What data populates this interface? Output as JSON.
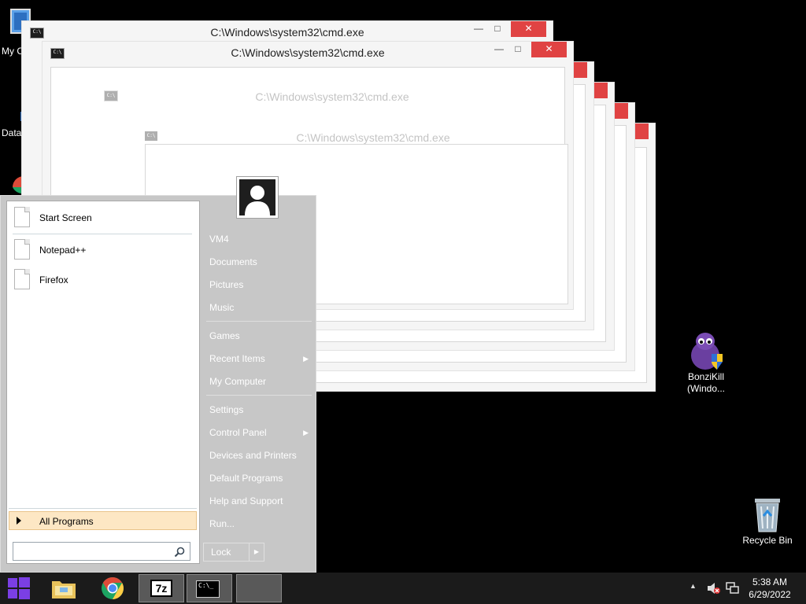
{
  "desktop": {
    "icons": [
      {
        "label": "My C"
      },
      {
        "label": "Data"
      },
      {
        "label": "BonziKill"
      },
      {
        "label": "(Windo..."
      },
      {
        "label": "Recycle Bin"
      }
    ]
  },
  "windows": [
    {
      "title": "C:\\Windows\\system32\\cmd.exe"
    },
    {
      "title": "C:\\Windows\\system32\\cmd.exe"
    },
    {
      "title": "C:\\Windows\\system32\\cmd.exe"
    },
    {
      "title": "C:\\Windows\\system32\\cmd.exe"
    }
  ],
  "window_controls": {
    "minimize": "—",
    "maximize": "□",
    "close": "✕"
  },
  "cmd_icon_text": "C:\\",
  "start_menu": {
    "pinned": [
      {
        "label": "Start Screen"
      },
      {
        "label": "Notepad++"
      },
      {
        "label": "Firefox"
      }
    ],
    "all_programs": "All Programs",
    "search_placeholder": "",
    "right_items": [
      {
        "label": "VM4"
      },
      {
        "label": "Documents"
      },
      {
        "label": "Pictures"
      },
      {
        "label": "Music"
      },
      {
        "label": "Games"
      },
      {
        "label": "Recent Items"
      },
      {
        "label": "My Computer"
      },
      {
        "label": "Settings"
      },
      {
        "label": "Control Panel"
      },
      {
        "label": "Devices and Printers"
      },
      {
        "label": "Default Programs"
      },
      {
        "label": "Help and Support"
      },
      {
        "label": "Run..."
      }
    ],
    "submenu_arrow": "▶",
    "lock_label": "Lock",
    "lock_arrow": "▶"
  },
  "taskbar": {
    "sevenzip_label": "7z",
    "cmd_label": "C:\\_",
    "tray_arrow": "▲",
    "time": "5:38 AM",
    "date": "6/29/2022"
  },
  "colors": {
    "close_red": "#e04343",
    "start_menu_bg": "#c7c7c7",
    "all_programs_highlight": "#fde7c4",
    "taskbar": "#1b1b1b",
    "start_logo": "#7b3fe4"
  }
}
